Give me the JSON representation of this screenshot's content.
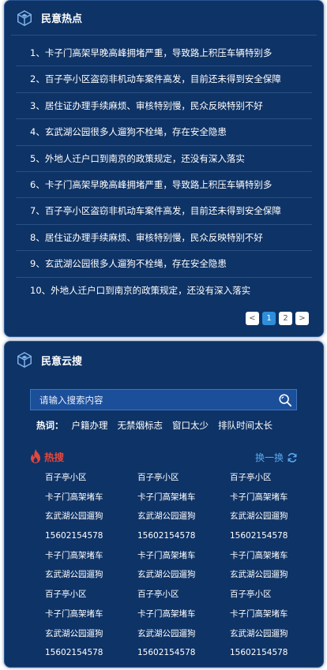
{
  "hotspot": {
    "title": "民意热点",
    "items": [
      "1、卡子门高架早晚高峰拥堵严重，导致路上积压车辆特别多",
      "2、百子亭小区盗窃非机动车案件高发，目前还未得到安全保障",
      "3、居住证办理手续麻烦、审核特别慢，民众反映特别不好",
      "4、玄武湖公园很多人遛狗不栓绳，存在安全隐患",
      "5、外地人迁户口到南京的政策规定，还没有深入落实",
      "6、卡子门高架早晚高峰拥堵严重，导致路上积压车辆特别多",
      "7、百子亭小区盗窃非机动车案件高发，目前还未得到安全保障",
      "8、居住证办理手续麻烦、审核特别慢，民众反映特别不好",
      "9、玄武湖公园很多人遛狗不栓绳，存在安全隐患",
      "10、外地人迁户口到南京的政策规定，还没有深入落实"
    ],
    "pager": {
      "prev": "<",
      "pages": [
        "1",
        "2"
      ],
      "next": ">",
      "current": "1"
    }
  },
  "cloud_search": {
    "title": "民意云搜",
    "search_placeholder": "请输入搜索内容",
    "hotwords_label": "热词：",
    "hotwords": [
      "户籍办理",
      "无禁烟标志",
      "窗口太少",
      "排队时间太长"
    ],
    "trending_label": "热搜",
    "refresh_label": "换一换",
    "trending": [
      "百子亭小区",
      "百子亭小区",
      "百子亭小区",
      "卡子门高架堵车",
      "卡子门高架堵车",
      "卡子门高架堵车",
      "玄武湖公园遛狗",
      "玄武湖公园遛狗",
      "玄武湖公园遛狗",
      "15602154578",
      "15602154578",
      "15602154578",
      "卡子门高架堵车",
      "卡子门高架堵车",
      "卡子门高架堵车",
      "玄武湖公园遛狗",
      "玄武湖公园遛狗",
      "玄武湖公园遛狗",
      "百子亭小区",
      "百子亭小区",
      "百子亭小区",
      "卡子门高架堵车",
      "卡子门高架堵车",
      "卡子门高架堵车",
      "玄武湖公园遛狗",
      "玄武湖公园遛狗",
      "玄武湖公园遛狗",
      "15602154578",
      "15602154578",
      "15602154578"
    ]
  },
  "colors": {
    "panel_bg": "#0e3366",
    "hot_red": "#e2483e",
    "link_blue": "#5aa9ee",
    "active_page": "#2f8ed9"
  },
  "icons": {
    "panel_icon": "cube-icon",
    "search": "search-icon",
    "trending": "flame-icon",
    "refresh": "refresh-icon"
  }
}
